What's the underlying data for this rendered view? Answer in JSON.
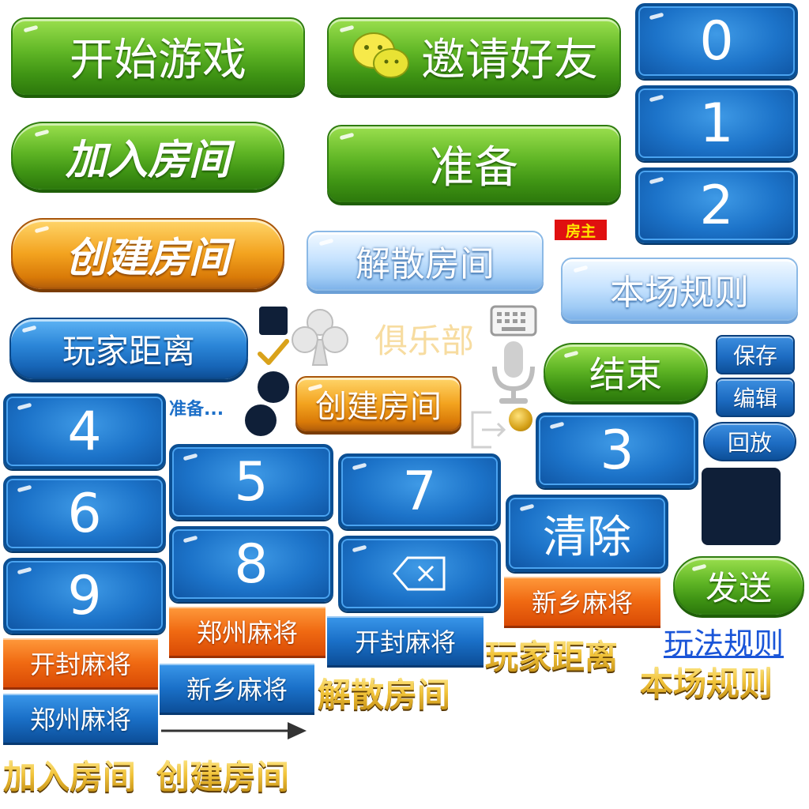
{
  "buttons": {
    "start_game": "开始游戏",
    "invite_friends": "邀请好友",
    "join_room": "加入房间",
    "ready": "准备",
    "create_room": "创建房间",
    "dissolve_room": "解散房间",
    "room_rules": "本场规则",
    "player_distance": "玩家距离",
    "end": "结束",
    "create_room_small": "创建房间",
    "send": "发送",
    "clear": "清除"
  },
  "small_buttons": {
    "save": "保存",
    "edit": "编辑",
    "replay": "回放"
  },
  "badges": {
    "host": "房主",
    "ready_status": "准备...",
    "club": "俱乐部"
  },
  "keypad": [
    "0",
    "1",
    "2",
    "3",
    "4",
    "5",
    "6",
    "7",
    "8",
    "9"
  ],
  "tabs": {
    "orange_xinxiang": "新乡麻将",
    "orange_zhengzhou": "郑州麻将",
    "orange_kaifeng": "开封麻将",
    "blue_kaifeng": "开封麻将",
    "blue_xinxiang": "新乡麻将",
    "blue_zhengzhou": "郑州麻将"
  },
  "gold_labels": {
    "player_distance": "玩家距离",
    "room_rules": "本场规则",
    "dissolve_room": "解散房间",
    "join_room": "加入房间",
    "create_room": "创建房间"
  },
  "links": {
    "game_rules": "玩法规则"
  },
  "icons": [
    "wechat-icon",
    "club-icon",
    "check-icon",
    "keyboard-icon",
    "microphone-icon",
    "exit-icon",
    "backspace-icon",
    "arrow-icon"
  ],
  "colors": {
    "green": "#4fa81c",
    "orange": "#f0a020",
    "blue": "#1c73c9",
    "dark": "#0f1f38",
    "gold": "#f2c43a",
    "link": "#1a55d8"
  }
}
